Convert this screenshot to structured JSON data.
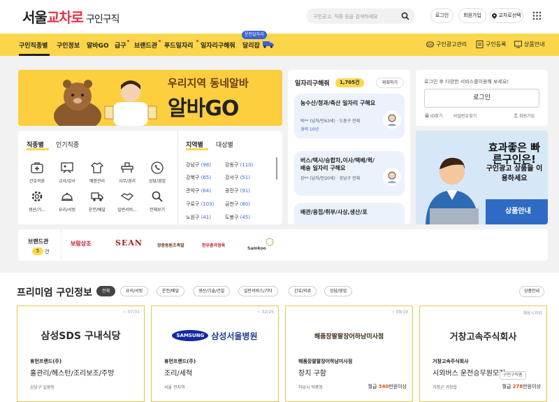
{
  "header": {
    "logo_part1": "서울",
    "logo_part2": "교차로",
    "logo_part3": "구인구직",
    "search_placeholder": "구인공고, 직종 등을 검색하세요",
    "login_label": "로그인",
    "signup_label": "회원가입",
    "branch_label": "교차로선택"
  },
  "nav": {
    "items": [
      "구인직종별",
      "구인정보",
      "알바GO",
      "급구",
      "브랜드관",
      "푸드일자리",
      "일자리구해줘",
      "달리잡"
    ],
    "pill": "운전일자리",
    "right": [
      "구인광고관리",
      "구인등록",
      "상품안내"
    ]
  },
  "banner": {
    "line1": "우리지역 동네알바",
    "line2": "알바GO"
  },
  "category": {
    "tabs": [
      "직종별",
      "인기직종"
    ],
    "items": [
      "간호의료",
      "교사/강사",
      "매장관리",
      "사무/경리",
      "상담/영업",
      "생산/기...",
      "요리/서빙",
      "운전/배달",
      "일반서비...",
      "전체보기"
    ],
    "region_tabs": [
      "지역별",
      "대상별"
    ],
    "regions": [
      {
        "name": "강남구",
        "count": "(98)"
      },
      {
        "name": "강동구",
        "count": "(110)"
      },
      {
        "name": "강북구",
        "count": "(65)"
      },
      {
        "name": "강서구",
        "count": "(51)"
      },
      {
        "name": "관악구",
        "count": "(64)"
      },
      {
        "name": "광진구",
        "count": "(91)"
      },
      {
        "name": "구로구",
        "count": "(103)"
      },
      {
        "name": "금천구",
        "count": "(80)"
      },
      {
        "name": "노원구",
        "count": "(41)"
      },
      {
        "name": "도봉구",
        "count": "(45)"
      }
    ]
  },
  "jobs": {
    "title": "일자리구해줘",
    "count": "1,705건",
    "more": "외회하기",
    "cards": [
      {
        "title": "농수산/청과/축산 일자리 구해요",
        "meta": "박** (남자/만63세) · 도봉구 전체",
        "extra": "경력 10년"
      },
      {
        "title": "버스/택시/승합차,이사/택배/퀵/배송 일자리 구해요",
        "meta": "강** (남자/만20세) · 강남구 전체",
        "extra": ""
      },
      {
        "title": "배관/용접/취부/사상,생산/포",
        "meta": "",
        "extra": ""
      }
    ]
  },
  "login": {
    "text": "로그인 후 다양한 서비스를이용해 보세요!",
    "button": "로그인",
    "id_find": "ID찾기",
    "pw_find": "비밀번호찾기",
    "signup": "회원가입"
  },
  "promo": {
    "line1": "효과좋은 빠른구인은!",
    "line2": "구인광고 상품을 이용하세요",
    "line3": "상품안내"
  },
  "brand": {
    "title": "브랜드관",
    "count": "5",
    "count_suffix": "건",
    "logos": [
      "보람상조",
      "SEAN",
      "장충동원조족발",
      "한우총각정육",
      "Samkoo"
    ]
  },
  "premium": {
    "title": "프리미엄 구인정보",
    "chips": [
      "전체",
      "요리/서빙",
      "운전/배달",
      "생산/기술/건설",
      "일반서비스/기타",
      "간호/의료",
      "상담/영업"
    ],
    "more": "상품안내",
    "cards": [
      {
        "deadline": "~ 07/31",
        "logo": "삼성SDS 구내식당",
        "company": "휴먼프랜드(주)",
        "job": "홀관리/헤스턴/조리보조/주방",
        "location": "강남구 일원동",
        "salary_pre": "",
        "salary_num": "",
        "salary_suf": "",
        "badge": ""
      },
      {
        "deadline": "~ 02/25",
        "logo": "삼성서울병원",
        "logo_mark": "SAMSUNG",
        "company": "휴먼프랜드(주)",
        "job": "조리/세척",
        "location": "서울 전지역",
        "salary_pre": "",
        "salary_num": "",
        "salary_suf": "",
        "badge": ""
      },
      {
        "deadline": "~ 09/19",
        "logo": "해품장팔팔장어하남미사점",
        "company": "해품장팔팔장어하남미사점",
        "job": "장치 구함",
        "location": "하남시 덕풍동",
        "salary_pre": "월급 ",
        "salary_num": "340",
        "salary_suf": "만원이상",
        "badge": ""
      },
      {
        "deadline": "채용시까지",
        "logo": "거창고속주식회사",
        "company": "거창고속주식회사",
        "job": "시외버스 운전승무원모집",
        "location": "거창군 거창읍",
        "salary_pre": "월급 ",
        "salary_num": "278",
        "salary_suf": "만원이상",
        "badge": "구인구직홈"
      }
    ]
  },
  "colors": {
    "accent": "#fbd64a",
    "brand_red": "#e8334a",
    "link_blue": "#3c63d6"
  }
}
